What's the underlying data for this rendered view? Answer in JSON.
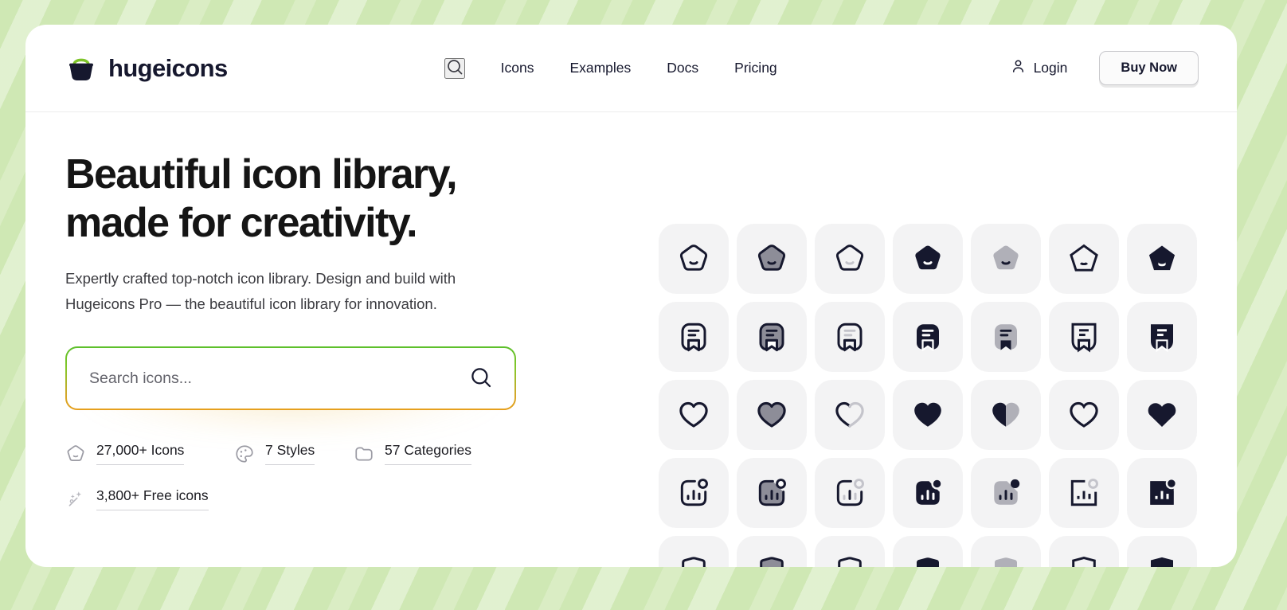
{
  "theme": {
    "page_background": "#cfe8b4",
    "card_background": "#ffffff",
    "brand_dark": "#16182e",
    "brand_green": "#7ec42a",
    "accent_amber": "#e6a01d",
    "tile_background": "#f3f3f4",
    "icon_dark": "#16182e",
    "icon_gray": "#9b9ba4"
  },
  "header": {
    "brand_name": "hugeicons",
    "brand_logo_icon": "basket-icon",
    "search_icon": "search-icon",
    "nav": [
      {
        "label": "Icons"
      },
      {
        "label": "Examples"
      },
      {
        "label": "Docs"
      },
      {
        "label": "Pricing"
      }
    ],
    "login": {
      "label": "Login",
      "icon": "user-icon"
    },
    "buy_now": {
      "label": "Buy Now"
    }
  },
  "hero": {
    "headline": "Beautiful icon library,\nmade for creativity.",
    "subtitle": "Expertly crafted top-notch icon library. Design and build with\nHugeicons Pro — the beautiful icon library for innovation.",
    "search": {
      "placeholder": "Search icons...",
      "value": "",
      "submit_icon": "search-icon"
    },
    "stats": [
      {
        "label": "27,000+ Icons",
        "icon": "pentagon-smile-icon"
      },
      {
        "label": "7 Styles",
        "icon": "palette-icon"
      },
      {
        "label": "57 Categories",
        "icon": "folder-icon"
      },
      {
        "label": "3,800+ Free icons",
        "icon": "sparkles-icon"
      }
    ]
  },
  "icon_showcase": {
    "columns": 7,
    "style_names": [
      "stroke-rounded",
      "duotone-rounded",
      "twotone-rounded",
      "solid-rounded",
      "bulk-rounded",
      "stroke-sharp",
      "solid-sharp"
    ],
    "rows": [
      {
        "icon": "pentagon-smile-icon",
        "name": "ai-beautify"
      },
      {
        "icon": "bookmark-certificate-icon",
        "name": "ai-book"
      },
      {
        "icon": "heart-icon",
        "name": "favourite"
      },
      {
        "icon": "bar-chart-badge-icon",
        "name": "analytics"
      },
      {
        "icon": "ai-shield-icon",
        "name": "ai-security"
      }
    ]
  }
}
